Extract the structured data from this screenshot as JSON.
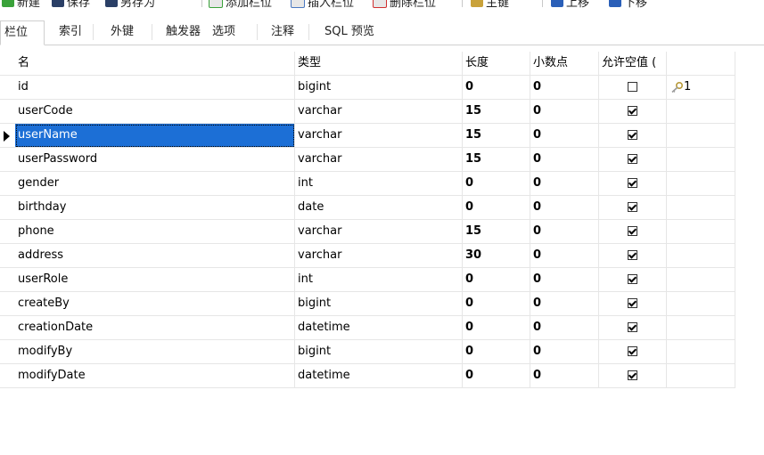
{
  "toolbar": {
    "new_label": "新建",
    "save_label": "保存",
    "saveas_label": "另存为",
    "add_field_label": "添加栏位",
    "insert_field_label": "插入栏位",
    "delete_field_label": "删除栏位",
    "primary_key_label": "主键",
    "move_up_label": "上移",
    "move_down_label": "下移"
  },
  "tabs": [
    {
      "label": "栏位"
    },
    {
      "label": "索引"
    },
    {
      "label": "外键"
    },
    {
      "label": "触发器"
    },
    {
      "label": "选项"
    },
    {
      "label": "注释"
    },
    {
      "label": "SQL 预览"
    }
  ],
  "grid": {
    "headers": {
      "name": "名",
      "type": "类型",
      "length": "长度",
      "decimals": "小数点",
      "allow_null": "允许空值 ("
    },
    "rows": [
      {
        "name": "id",
        "type": "bigint",
        "length": "0",
        "decimals": "0",
        "allow_null": false,
        "key": "1"
      },
      {
        "name": "userCode",
        "type": "varchar",
        "length": "15",
        "decimals": "0",
        "allow_null": true,
        "key": ""
      },
      {
        "name": "userName",
        "type": "varchar",
        "length": "15",
        "decimals": "0",
        "allow_null": true,
        "key": ""
      },
      {
        "name": "userPassword",
        "type": "varchar",
        "length": "15",
        "decimals": "0",
        "allow_null": true,
        "key": ""
      },
      {
        "name": "gender",
        "type": "int",
        "length": "0",
        "decimals": "0",
        "allow_null": true,
        "key": ""
      },
      {
        "name": "birthday",
        "type": "date",
        "length": "0",
        "decimals": "0",
        "allow_null": true,
        "key": ""
      },
      {
        "name": "phone",
        "type": "varchar",
        "length": "15",
        "decimals": "0",
        "allow_null": true,
        "key": ""
      },
      {
        "name": "address",
        "type": "varchar",
        "length": "30",
        "decimals": "0",
        "allow_null": true,
        "key": ""
      },
      {
        "name": "userRole",
        "type": "int",
        "length": "0",
        "decimals": "0",
        "allow_null": true,
        "key": ""
      },
      {
        "name": "createBy",
        "type": "bigint",
        "length": "0",
        "decimals": "0",
        "allow_null": true,
        "key": ""
      },
      {
        "name": "creationDate",
        "type": "datetime",
        "length": "0",
        "decimals": "0",
        "allow_null": true,
        "key": ""
      },
      {
        "name": "modifyBy",
        "type": "bigint",
        "length": "0",
        "decimals": "0",
        "allow_null": true,
        "key": ""
      },
      {
        "name": "modifyDate",
        "type": "datetime",
        "length": "0",
        "decimals": "0",
        "allow_null": true,
        "key": ""
      }
    ]
  },
  "colors": {
    "selection": "#1c6fd6",
    "grid_line": "#e6e6e6"
  }
}
